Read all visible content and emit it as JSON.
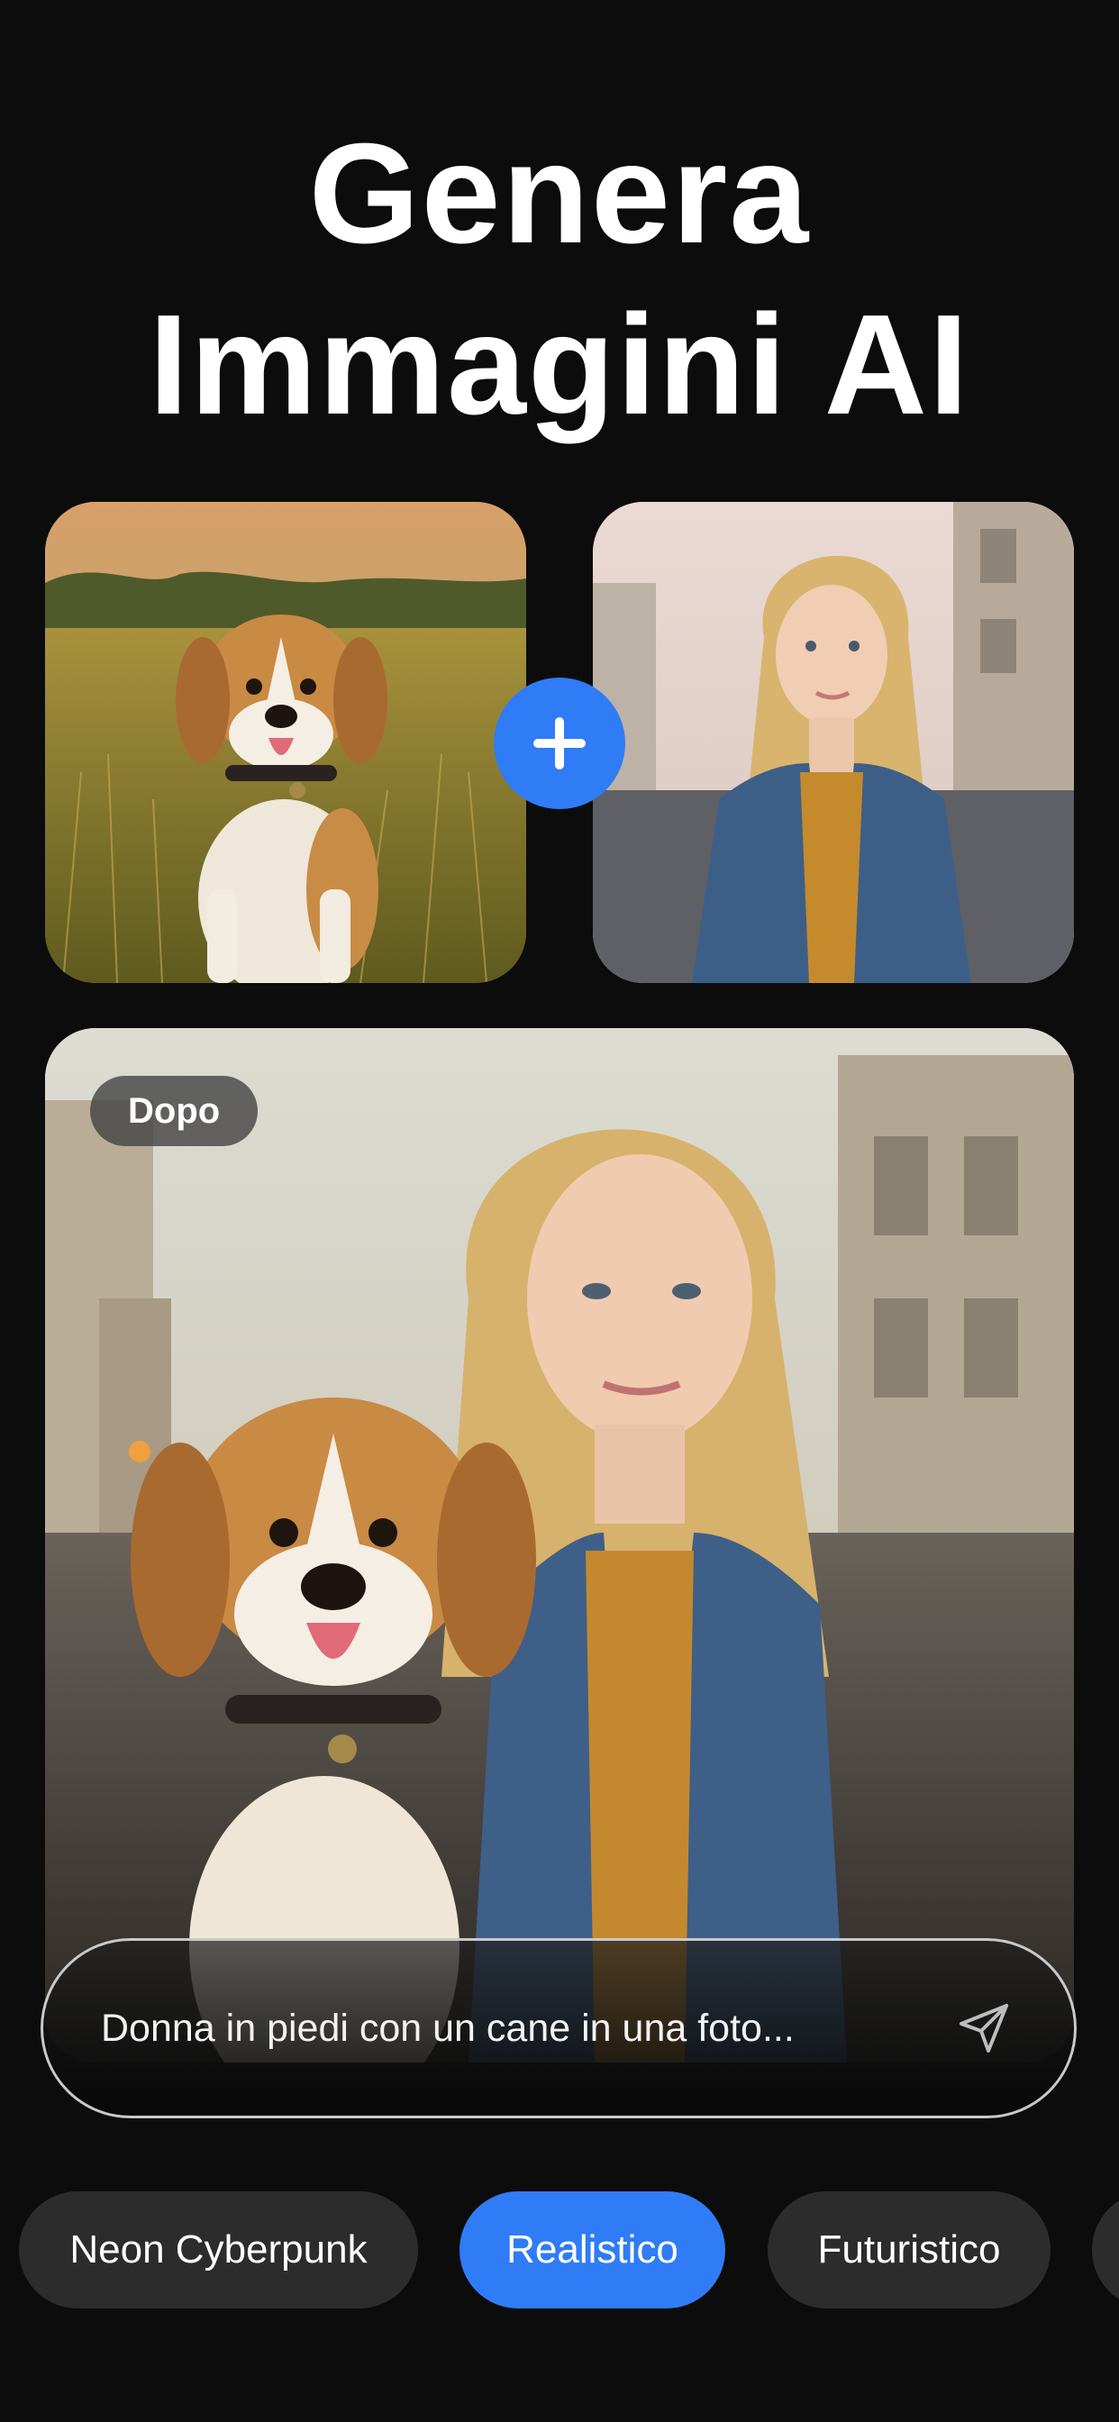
{
  "header": {
    "title_line1": "Genera",
    "title_line2": "Immagini AI"
  },
  "inputs": {
    "left_image": "beagle-photo",
    "right_image": "woman-photo",
    "combine_icon": "plus-icon"
  },
  "result": {
    "badge": "Dopo",
    "image": "woman-with-beagle-photo"
  },
  "prompt": {
    "text": "Donna in piedi con un cane in una foto...",
    "send_icon": "send-icon"
  },
  "styles": {
    "items": [
      "Neon Cyberpunk",
      "Realistico",
      "Futuristico"
    ],
    "selected": "Realistico"
  },
  "colors": {
    "accent": "#2f7cf6",
    "background": "#0c0c0c",
    "chip": "#2c2c2c"
  }
}
